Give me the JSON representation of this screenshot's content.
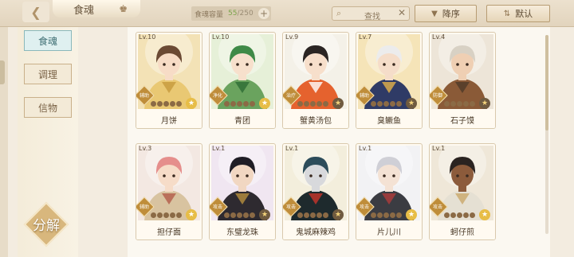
{
  "header": {
    "back_icon": "back-chevron-icon",
    "title": "食魂",
    "crown_icon": "crown-icon",
    "capacity_label": "食魂容量",
    "capacity_current": "55",
    "capacity_max": "/250",
    "add_label": "+",
    "search_placeholder": "查找",
    "search_clear": "✕",
    "sort_order_label": "降序",
    "sort_mode_label": "默认"
  },
  "sidebar": {
    "tabs": [
      {
        "label": "食魂",
        "active": true
      },
      {
        "label": "调理",
        "active": false
      },
      {
        "label": "信物",
        "active": false
      }
    ],
    "decompose_label": "分解"
  },
  "cards": [
    {
      "level": "Lv.10",
      "name": "月饼",
      "role": "辅助",
      "bg": "#f3e2b6",
      "skin": "#f7dcc6",
      "hair": "#6b4a34",
      "cloth": "#e9c873",
      "accent": "#c59a3c",
      "star_btn_gold": true
    },
    {
      "level": "Lv.10",
      "name": "青团",
      "role": "净化",
      "bg": "#e6f0d8",
      "skin": "#f7e0cc",
      "hair": "#3f8a47",
      "cloth": "#6aa35e",
      "accent": "#2d6b33",
      "star_btn_gold": true
    },
    {
      "level": "Lv.9",
      "name": "蟹黄汤包",
      "role": "治疗",
      "bg": "#f4f1e8",
      "skin": "#f7dfcb",
      "hair": "#2b2523",
      "cloth": "#e5622e",
      "accent": "#ffffff",
      "star_btn_gold": false
    },
    {
      "level": "Lv.7",
      "name": "臭鳜鱼",
      "role": "辅助",
      "bg": "#f5e4b8",
      "skin": "#f5ddc9",
      "hair": "#ececec",
      "cloth": "#2f3b66",
      "accent": "#e3b34a",
      "star_btn_gold": false
    },
    {
      "level": "Lv.4",
      "name": "石子馍",
      "role": "防御",
      "bg": "#ede5d8",
      "skin": "#efcfb3",
      "hair": "#d8d1c4",
      "cloth": "#8a5a37",
      "accent": "#4e3a28",
      "star_btn_gold": false
    },
    {
      "level": "Lv.3",
      "name": "担仔面",
      "role": "辅助",
      "bg": "#f3e8e2",
      "skin": "#f6dcc8",
      "hair": "#e58e8c",
      "cloth": "#d8c3a0",
      "accent": "#b35b48",
      "star_btn_gold": true
    },
    {
      "level": "Lv.1",
      "name": "东璧龙珠",
      "role": "攻击",
      "bg": "#f0e6f1",
      "skin": "#f1d7c2",
      "hair": "#1f1d25",
      "cloth": "#2e2a30",
      "accent": "#b8903f",
      "star_btn_gold": false
    },
    {
      "level": "Lv.1",
      "name": "鬼城麻辣鸡",
      "role": "攻击",
      "bg": "#f3eedc",
      "skin": "#d8d9dc",
      "hair": "#2c4c5a",
      "cloth": "#1e2a2d",
      "accent": "#c8342b",
      "star_btn_gold": false
    },
    {
      "level": "Lv.1",
      "name": "片儿川",
      "role": "攻击",
      "bg": "#f2f2f4",
      "skin": "#f4e2d4",
      "hair": "#cfcfd6",
      "cloth": "#3b3c42",
      "accent": "#b03b3b",
      "star_btn_gold": true
    },
    {
      "level": "Lv.1",
      "name": "蚵仔煎",
      "role": "攻击",
      "bg": "#efe7d8",
      "skin": "#8c5b3b",
      "hair": "#2a2320",
      "cloth": "#e5e0d3",
      "accent": "#c9a86a",
      "star_btn_gold": true
    }
  ]
}
